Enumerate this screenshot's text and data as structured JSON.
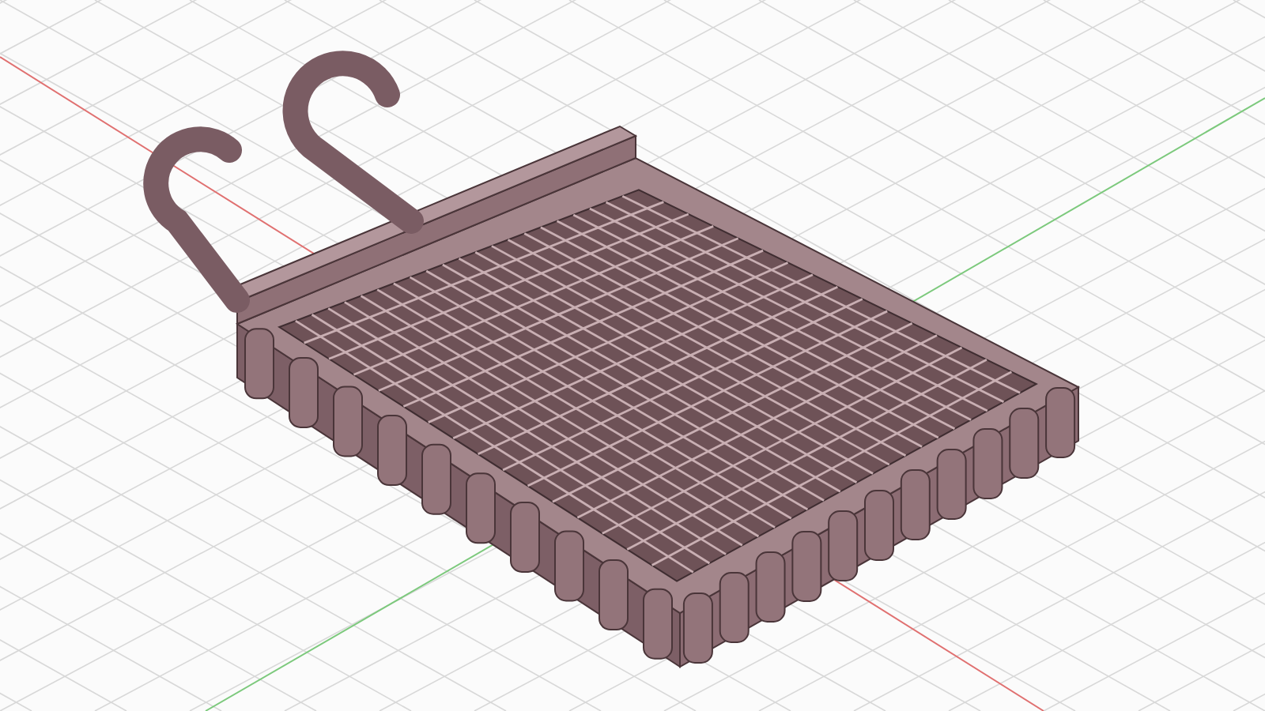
{
  "viewport": {
    "kind": "model-view"
  }
}
